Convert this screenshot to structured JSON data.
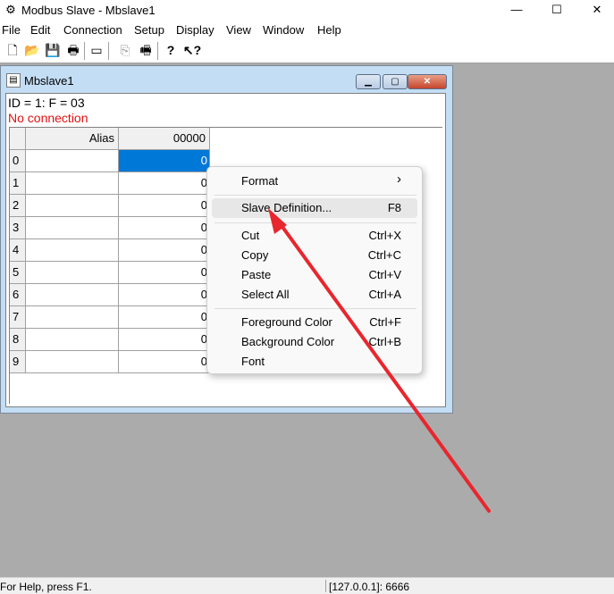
{
  "app": {
    "title": "Modbus Slave - Mbslave1",
    "icon_name": "modbus-slave-app-icon",
    "controls": {
      "minimize": "—",
      "maximize": "☐",
      "close": "✕"
    }
  },
  "menubar": {
    "items": [
      {
        "label": "File"
      },
      {
        "label": "Edit"
      },
      {
        "label": "Connection"
      },
      {
        "label": "Setup"
      },
      {
        "label": "Display"
      },
      {
        "label": "View"
      },
      {
        "label": "Window"
      },
      {
        "label": "Help"
      }
    ]
  },
  "toolbar": {
    "buttons": [
      {
        "name": "new-icon",
        "glyph": "🗋"
      },
      {
        "name": "open-folder-icon",
        "glyph": "📂"
      },
      {
        "name": "save-icon",
        "glyph": "💾"
      },
      {
        "name": "print-icon",
        "glyph": "🖶"
      },
      {
        "name": "window-icon",
        "glyph": "▭"
      },
      {
        "name": "disabled-tool-icon",
        "glyph": "⎘"
      },
      {
        "name": "printer-setup-icon",
        "glyph": "🖷"
      },
      {
        "name": "about-icon",
        "glyph": "?"
      },
      {
        "name": "context-help-icon",
        "glyph": "↖?"
      }
    ]
  },
  "child_window": {
    "title": "Mbslave1",
    "id_line": "ID = 1: F = 03",
    "status_line": "No connection",
    "status_color": "#e01010",
    "grid": {
      "headers": {
        "alias": "Alias",
        "column": "00000"
      },
      "rows": [
        {
          "num": "0",
          "alias": "",
          "value": "0"
        },
        {
          "num": "1",
          "alias": "",
          "value": "0"
        },
        {
          "num": "2",
          "alias": "",
          "value": "0"
        },
        {
          "num": "3",
          "alias": "",
          "value": "0"
        },
        {
          "num": "4",
          "alias": "",
          "value": "0"
        },
        {
          "num": "5",
          "alias": "",
          "value": "0"
        },
        {
          "num": "6",
          "alias": "",
          "value": "0"
        },
        {
          "num": "7",
          "alias": "",
          "value": "0"
        },
        {
          "num": "8",
          "alias": "",
          "value": "0"
        },
        {
          "num": "9",
          "alias": "",
          "value": "0"
        }
      ],
      "selected_row": "0",
      "selection_color": "#0078d7"
    }
  },
  "context_menu": {
    "items": [
      {
        "label": "Format",
        "shortcut": "›"
      },
      {
        "label": "Slave Definition...",
        "shortcut": "F8",
        "highlighted": true
      },
      {
        "label": "Cut",
        "shortcut": "Ctrl+X"
      },
      {
        "label": "Copy",
        "shortcut": "Ctrl+C"
      },
      {
        "label": "Paste",
        "shortcut": "Ctrl+V"
      },
      {
        "label": "Select All",
        "shortcut": "Ctrl+A"
      },
      {
        "label": "Foreground Color",
        "shortcut": "Ctrl+F"
      },
      {
        "label": "Background Color",
        "shortcut": "Ctrl+B"
      },
      {
        "label": "Font",
        "shortcut": ""
      }
    ]
  },
  "statusbar": {
    "help": "For Help, press F1.",
    "address": "[127.0.0.1]: 6666"
  },
  "annotation": {
    "arrow_color": "#e8262e"
  }
}
